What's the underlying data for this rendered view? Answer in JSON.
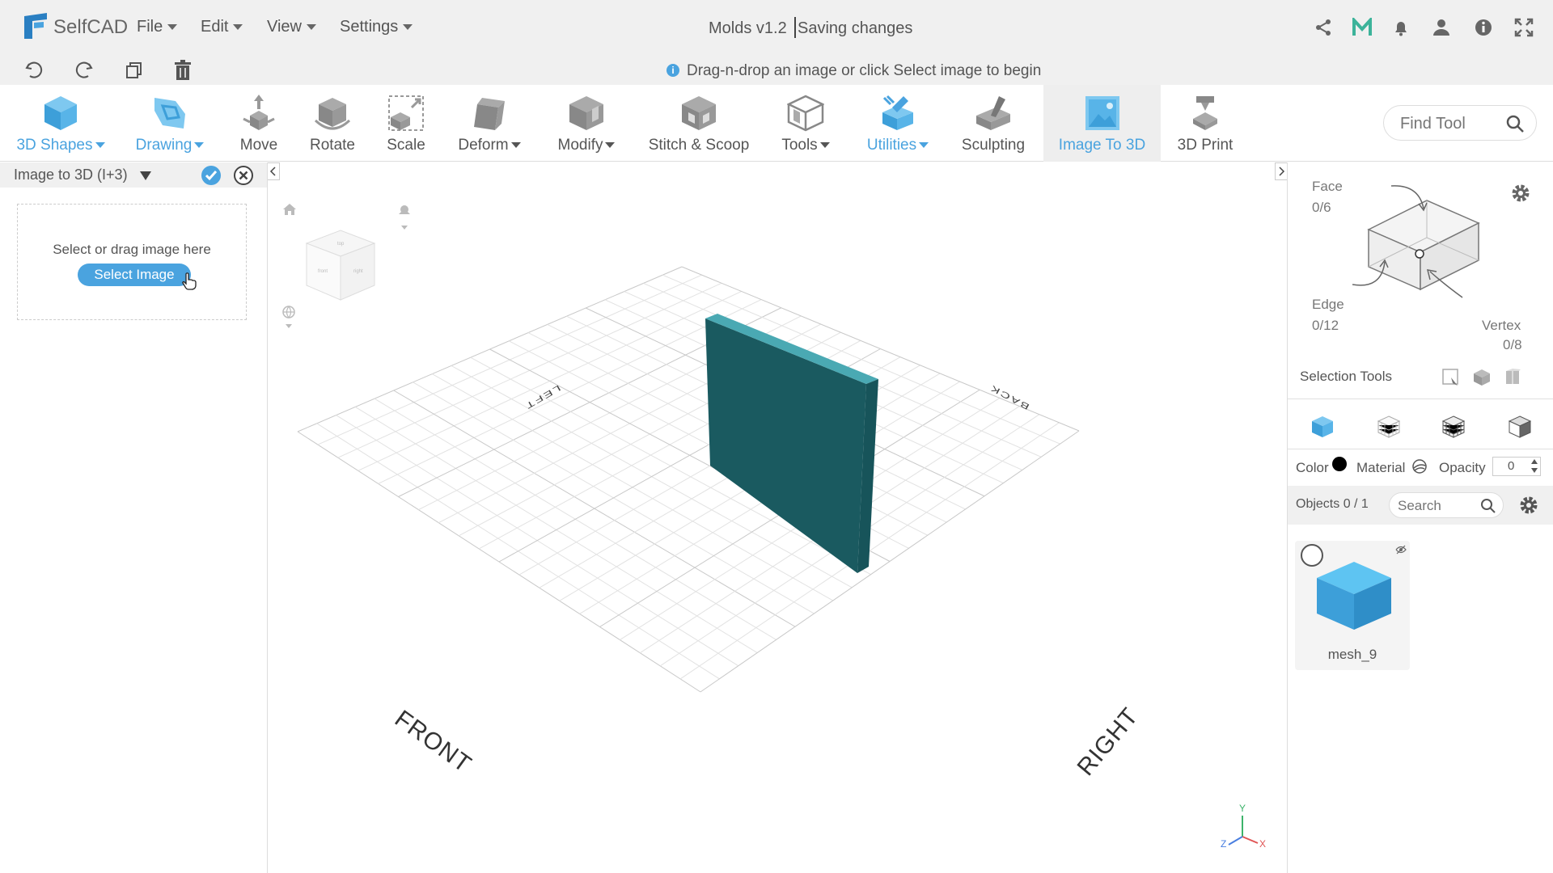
{
  "app": {
    "logo": "SelfCAD",
    "menus": [
      "File",
      "Edit",
      "View",
      "Settings"
    ],
    "project_name": "Molds v1.2",
    "save_status": "Saving changes",
    "hint": "Drag-n-drop an image or click Select image to begin",
    "find_tool_placeholder": "Find Tool"
  },
  "toolbar": {
    "tools": [
      {
        "label": "3D Shapes",
        "icon": "cube-icon",
        "dropdown": true,
        "active": false,
        "blue": true
      },
      {
        "label": "Drawing",
        "icon": "drawing-icon",
        "dropdown": true,
        "active": false,
        "blue": true
      },
      {
        "label": "Move",
        "icon": "move-icon",
        "dropdown": false,
        "active": false
      },
      {
        "label": "Rotate",
        "icon": "rotate-icon",
        "dropdown": false,
        "active": false
      },
      {
        "label": "Scale",
        "icon": "scale-icon",
        "dropdown": false,
        "active": false
      },
      {
        "label": "Deform",
        "icon": "deform-icon",
        "dropdown": true,
        "active": false
      },
      {
        "label": "Modify",
        "icon": "modify-icon",
        "dropdown": true,
        "active": false
      },
      {
        "label": "Stitch & Scoop",
        "icon": "stitch-scoop-icon",
        "dropdown": false,
        "active": false
      },
      {
        "label": "Tools",
        "icon": "tools-icon",
        "dropdown": true,
        "active": false
      },
      {
        "label": "Utilities",
        "icon": "utilities-icon",
        "dropdown": true,
        "active": false,
        "blue": true
      },
      {
        "label": "Sculpting",
        "icon": "sculpting-icon",
        "dropdown": false,
        "active": false
      },
      {
        "label": "Image To 3D",
        "icon": "image-to-3d-icon",
        "dropdown": false,
        "active": true,
        "blue": true
      },
      {
        "label": "3D Print",
        "icon": "3d-print-icon",
        "dropdown": false,
        "active": false
      }
    ]
  },
  "left_panel": {
    "title": "Image to 3D (I+3)",
    "drop_text": "Select or drag image here",
    "select_button": "Select Image"
  },
  "viewport": {
    "labels": {
      "left": "LEFT",
      "back": "BACK",
      "front": "FRONT",
      "right": "RIGHT"
    },
    "axes": {
      "x": "X",
      "y": "Y",
      "z": "Z"
    },
    "colors": {
      "wall": "#1a5a60",
      "wall_top": "#4aa9b3",
      "wall_side": "#17545a",
      "grid": "#d8d8d8"
    }
  },
  "right_panel": {
    "face_label": "Face",
    "face_count": "0/6",
    "edge_label": "Edge",
    "edge_count": "0/12",
    "vertex_label": "Vertex",
    "vertex_count": "0/8",
    "selection_tools": "Selection Tools",
    "color_label": "Color",
    "material_label": "Material",
    "opacity_label": "Opacity",
    "opacity_value": "0",
    "objects_label": "Objects 0 / 1",
    "search_placeholder": "Search",
    "object_name": "mesh_9"
  },
  "colors": {
    "accent": "#4aa3df",
    "menubar": "#f0f0f0",
    "object_blue": "#3d9fd9"
  }
}
